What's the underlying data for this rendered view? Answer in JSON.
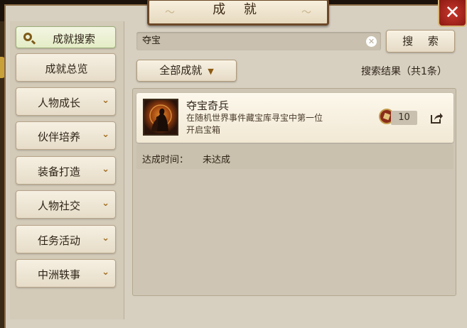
{
  "window": {
    "title": "成 就",
    "close_label": "✕"
  },
  "sidebar": {
    "items": [
      {
        "label": "成就搜索",
        "active": true,
        "expandable": false
      },
      {
        "label": "成就总览",
        "active": false,
        "expandable": false
      },
      {
        "label": "人物成长",
        "active": false,
        "expandable": true
      },
      {
        "label": "伙伴培养",
        "active": false,
        "expandable": true
      },
      {
        "label": "装备打造",
        "active": false,
        "expandable": true
      },
      {
        "label": "人物社交",
        "active": false,
        "expandable": true
      },
      {
        "label": "任务活动",
        "active": false,
        "expandable": true
      },
      {
        "label": "中洲轶事",
        "active": false,
        "expandable": true
      }
    ],
    "chevron": "⌄"
  },
  "search": {
    "value": "夺宝",
    "button_label": "搜 索",
    "clear_icon": "✕"
  },
  "filter": {
    "label": "全部成就",
    "arrow": "▼"
  },
  "result_count": "搜索结果（共1条）",
  "results": [
    {
      "title": "夺宝奇兵",
      "description": "在随机世界事件藏宝库寻宝中第一位开启宝箱",
      "points": "10",
      "time_label": "达成时间：",
      "time_value": "未达成"
    }
  ],
  "colors": {
    "panel_bg": "#d7d0c1",
    "accent_brown": "#a16d1e",
    "close_red": "#c8372d"
  }
}
